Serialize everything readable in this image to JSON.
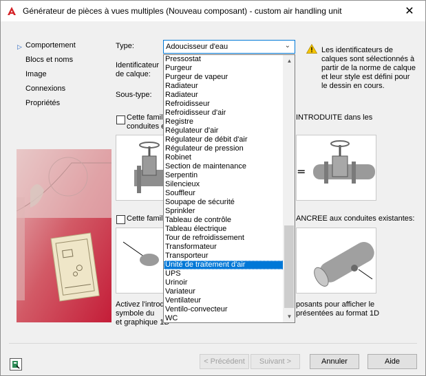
{
  "window": {
    "title": "Générateur de pièces à vues multiples (Nouveau composant) - custom air handling unit",
    "close_glyph": "✕"
  },
  "nav": {
    "marker": "▷",
    "items": [
      {
        "label": "Comportement",
        "active": true
      },
      {
        "label": "Blocs et noms",
        "active": false
      },
      {
        "label": "Image",
        "active": false
      },
      {
        "label": "Connexions",
        "active": false
      },
      {
        "label": "Propriétés",
        "active": false
      }
    ]
  },
  "form": {
    "type_label": "Type:",
    "type_value": "Adoucisseur d'eau",
    "identifier_label_1": "Identificateur",
    "identifier_label_2": "de calque:",
    "subtype_label": "Sous-type:",
    "info_text": "Les identificateurs de calques sont sélectionnés à partir de la norme de calque et leur style est défini pour le dessin en cours.",
    "check1_text_a": "Cette famill",
    "check1_text_b": "INTRODUITE dans les",
    "check1_text_c": "conduites e",
    "check2_text_a": "Cette famill",
    "check2_text_b": "ANCREE aux conduites existantes:",
    "desc_a1": "Activez l'introd",
    "desc_a2": "symbole du",
    "desc_a3": "et graphique 1D",
    "desc_b1": "posants pour afficher le",
    "desc_b2": "présentées au format 1D"
  },
  "dropdown": {
    "items": [
      "Pressostat",
      "Purgeur",
      "Purgeur de vapeur",
      "Radiateur",
      "Radiateur",
      "Refroidisseur",
      "Refroidisseur d'air",
      "Registre",
      "Régulateur d'air",
      "Régulateur de débit d'air",
      "Régulateur de pression",
      "Robinet",
      "Section de maintenance",
      "Serpentin",
      "Silencieux",
      "Souffleur",
      "Soupape de sécurité",
      "Sprinkler",
      "Tableau de contrôle",
      "Tableau électrique",
      "Tour de refroidissement",
      "Transformateur",
      "Transporteur",
      "Unité de traitement d'air",
      "UPS",
      "Urinoir",
      "Variateur",
      "Ventilateur",
      "Ventilo-convecteur",
      "WC"
    ],
    "selected_index": 23
  },
  "buttons": {
    "prev": "< Précédent",
    "next": "Suivant >",
    "cancel": "Annuler",
    "help": "Aide"
  }
}
